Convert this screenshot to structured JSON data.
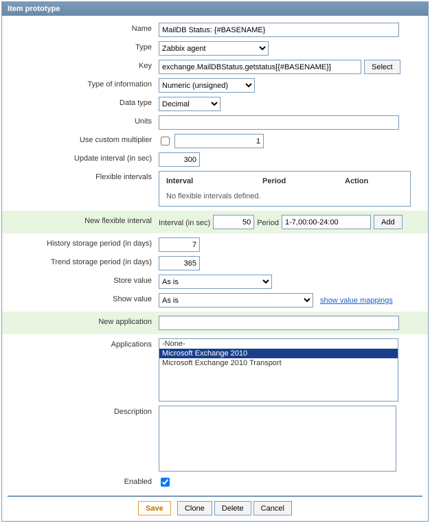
{
  "panel_title": "Item prototype",
  "labels": {
    "name": "Name",
    "type": "Type",
    "key": "Key",
    "info_type": "Type of information",
    "data_type": "Data type",
    "units": "Units",
    "use_mult": "Use custom multiplier",
    "update_int": "Update interval (in sec)",
    "flex_int": "Flexible intervals",
    "new_flex_int": "New flexible interval",
    "interval_in_sec": "Interval (in sec)",
    "period": "Period",
    "history": "History storage period (in days)",
    "trend": "Trend storage period (in days)",
    "store_value": "Store value",
    "show_value": "Show value",
    "new_app": "New application",
    "apps": "Applications",
    "desc": "Description",
    "enabled": "Enabled"
  },
  "flex_table": {
    "col_interval": "Interval",
    "col_period": "Period",
    "col_action": "Action",
    "empty_msg": "No flexible intervals defined."
  },
  "values": {
    "name": "MailDB Status: {#BASENAME}",
    "type": "Zabbix agent",
    "key": "exchange.MailDBStatus.getstatus[{#BASENAME}]",
    "info_type": "Numeric (unsigned)",
    "data_type": "Decimal",
    "units": "",
    "use_mult_checked": false,
    "mult_value": "1",
    "update_int": "300",
    "new_flex_sec": "50",
    "new_flex_period": "1-7,00:00-24:00",
    "history": "7",
    "trend": "365",
    "store_value": "As is",
    "show_value": "As is",
    "new_app": "",
    "desc": "",
    "enabled_checked": true
  },
  "applications": {
    "options": [
      "-None-",
      "Microsoft Exchange 2010",
      "Microsoft Exchange 2010 Transport"
    ],
    "selected_index": 1
  },
  "links": {
    "show_mappings": "show value mappings"
  },
  "buttons": {
    "select": "Select",
    "add": "Add",
    "save": "Save",
    "clone": "Clone",
    "delete": "Delete",
    "cancel": "Cancel"
  }
}
